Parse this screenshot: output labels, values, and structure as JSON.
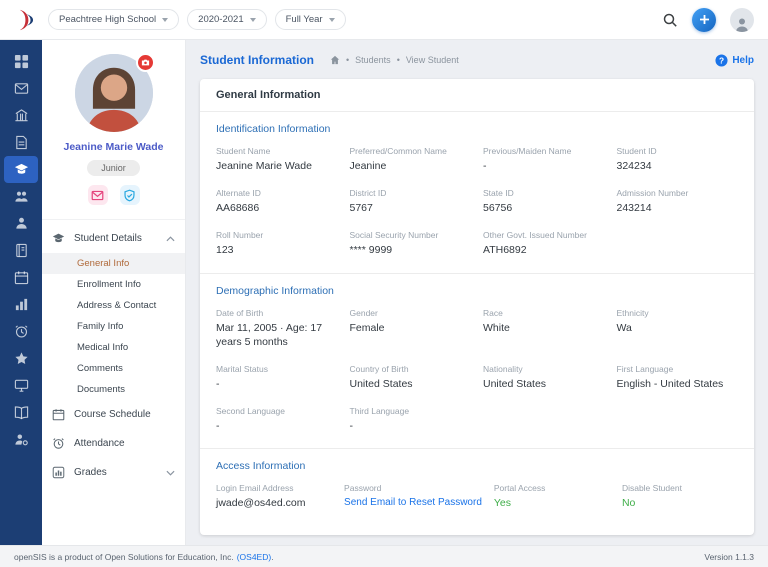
{
  "colors": {
    "rail_bg": "#1c3e74",
    "rail_active_bg": "#2d62c1",
    "accent_blue": "#1a68d4",
    "section_blue": "#2d6fb5",
    "active_menu_text": "#b06a3b",
    "green": "#3fae49",
    "link_blue": "#1a73e8",
    "camera_badge_red": "#e53935"
  },
  "header": {
    "selectors": [
      {
        "label": "Peachtree High School"
      },
      {
        "label": "2020-2021"
      },
      {
        "label": "Full Year"
      }
    ],
    "icons": [
      "opensis-logo",
      "search-icon",
      "add-icon",
      "account-icon"
    ]
  },
  "rail": {
    "items": [
      {
        "name": "dashboard"
      },
      {
        "name": "messages"
      },
      {
        "name": "school-info"
      },
      {
        "name": "forms"
      },
      {
        "name": "students",
        "active": true
      },
      {
        "name": "parents"
      },
      {
        "name": "users"
      },
      {
        "name": "courses"
      },
      {
        "name": "calendar"
      },
      {
        "name": "grades"
      },
      {
        "name": "attendance"
      },
      {
        "name": "behavior"
      },
      {
        "name": "reports"
      },
      {
        "name": "library"
      },
      {
        "name": "settings"
      }
    ]
  },
  "sidebar": {
    "student": {
      "name": "Jeanine Marie Wade",
      "grade": "Junior"
    },
    "quick_icons": [
      "email-icon",
      "shield-check-icon"
    ],
    "menu": [
      {
        "label": "Student Details",
        "icon": "graduation-cap",
        "expanded": true
      },
      {
        "label": "Course Schedule",
        "icon": "calendar"
      },
      {
        "label": "Attendance",
        "icon": "alarm-clock"
      },
      {
        "label": "Grades",
        "icon": "bar-chart",
        "expanded": false
      }
    ],
    "student_details_children": [
      "General Info",
      "Enrollment Info",
      "Address & Contact",
      "Family Info",
      "Medical Info",
      "Comments",
      "Documents"
    ],
    "active_child": "General Info"
  },
  "page": {
    "title": "Student Information",
    "separator": "•",
    "breadcrumb": [
      "Students",
      "View Student"
    ],
    "help": "Help"
  },
  "info": {
    "card_title": "General Information",
    "sections": [
      {
        "title": "Identification Information",
        "rows": [
          [
            {
              "label": "Student Name",
              "value": "Jeanine Marie Wade"
            },
            {
              "label": "Preferred/Common Name",
              "value": "Jeanine"
            },
            {
              "label": "Previous/Maiden Name",
              "value": "-"
            },
            {
              "label": "Student ID",
              "value": "324234"
            }
          ],
          [
            {
              "label": "Alternate ID",
              "value": "AA68686"
            },
            {
              "label": "District ID",
              "value": "5767"
            },
            {
              "label": "State ID",
              "value": "56756"
            },
            {
              "label": "Admission Number",
              "value": "243214"
            }
          ],
          [
            {
              "label": "Roll Number",
              "value": "123"
            },
            {
              "label": "Social Security Number",
              "value": "**** 9999"
            },
            {
              "label": "Other Govt. Issued Number",
              "value": "ATH6892"
            }
          ]
        ]
      },
      {
        "title": "Demographic Information",
        "rows": [
          [
            {
              "label": "Date of Birth",
              "value": "Mar 11, 2005  ·  Age: 17 years 5 months"
            },
            {
              "label": "Gender",
              "value": "Female"
            },
            {
              "label": "Race",
              "value": "White"
            },
            {
              "label": "Ethnicity",
              "value": "Wa"
            }
          ],
          [
            {
              "label": "Marital Status",
              "value": "-"
            },
            {
              "label": "Country of Birth",
              "value": "United States"
            },
            {
              "label": "Nationality",
              "value": "United States"
            },
            {
              "label": "First Language",
              "value": "English - United States"
            }
          ],
          [
            {
              "label": "Second Language",
              "value": "-"
            },
            {
              "label": "Third Language",
              "value": "-"
            }
          ]
        ]
      },
      {
        "title": "Access Information",
        "rows": [
          [
            {
              "label": "Login Email Address",
              "value": "jwade@os4ed.com"
            },
            {
              "label": "Password",
              "value": "Send Email to Reset Password"
            },
            {
              "label": "Portal Access",
              "value": "Yes"
            },
            {
              "label": "Disable Student",
              "value": "No"
            }
          ]
        ]
      }
    ]
  },
  "footer": {
    "left": "openSIS is a product of Open Solutions for Education, Inc.",
    "link": "(OS4ED)",
    "suffix": ".",
    "version": "Version 1.1.3"
  }
}
